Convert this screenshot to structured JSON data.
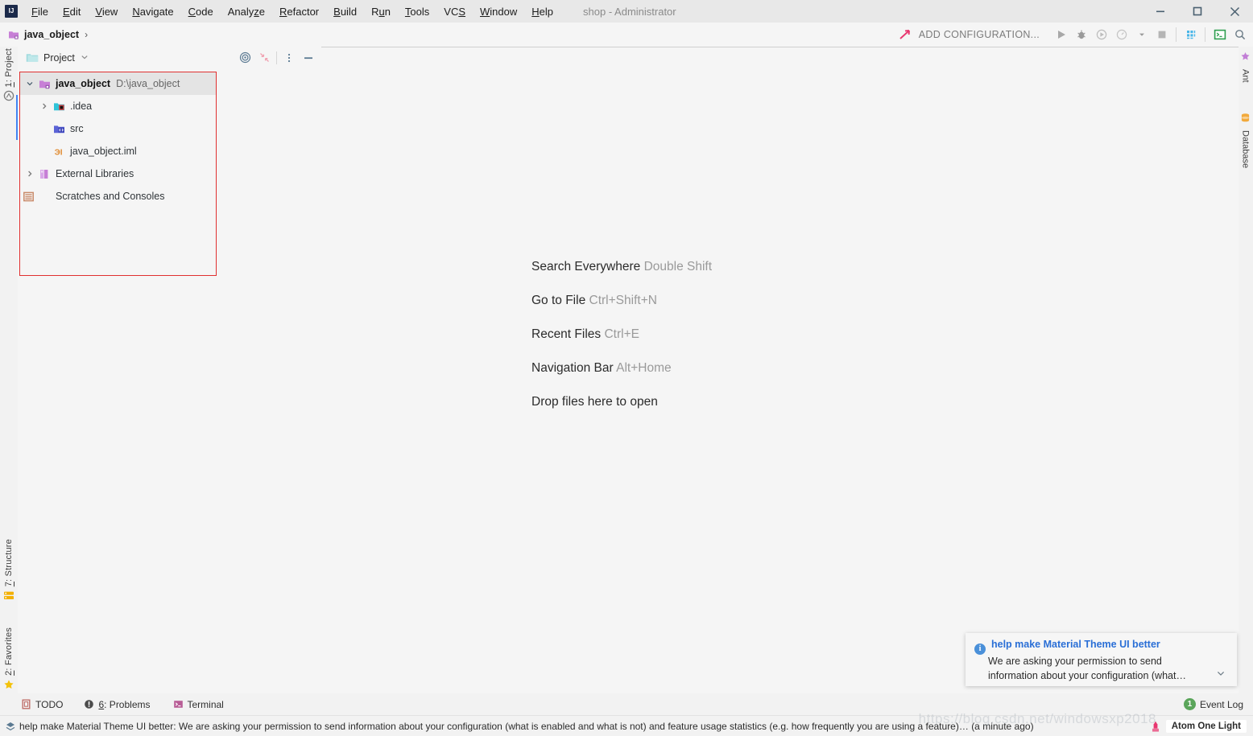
{
  "window": {
    "app_icon": "IJ",
    "title": "shop - Administrator",
    "controls": {
      "minimize": "minimize-icon",
      "maximize": "maximize-icon",
      "close": "close-icon"
    }
  },
  "menubar": {
    "items": [
      {
        "label": "File",
        "mnemonic": "F"
      },
      {
        "label": "Edit",
        "mnemonic": "E"
      },
      {
        "label": "View",
        "mnemonic": "V"
      },
      {
        "label": "Navigate",
        "mnemonic": "N"
      },
      {
        "label": "Code",
        "mnemonic": "C"
      },
      {
        "label": "Analyze",
        "mnemonic": "z"
      },
      {
        "label": "Refactor",
        "mnemonic": "R"
      },
      {
        "label": "Build",
        "mnemonic": "B"
      },
      {
        "label": "Run",
        "mnemonic": "u"
      },
      {
        "label": "Tools",
        "mnemonic": "T"
      },
      {
        "label": "VCS",
        "mnemonic": "S"
      },
      {
        "label": "Window",
        "mnemonic": "W"
      },
      {
        "label": "Help",
        "mnemonic": "H"
      }
    ]
  },
  "navbar": {
    "breadcrumb": {
      "label": "java_object",
      "separator": "›",
      "icon": "module-folder-icon"
    },
    "run_config": "ADD CONFIGURATION...",
    "buttons": [
      {
        "name": "run-button",
        "icon": "play-icon"
      },
      {
        "name": "debug-button",
        "icon": "bug-icon"
      },
      {
        "name": "run-with-coverage-button",
        "icon": "coverage-icon"
      },
      {
        "name": "profiler-button",
        "icon": "profiler-icon"
      },
      {
        "name": "profiler-dropdown",
        "icon": "chevron-down-icon"
      },
      {
        "name": "stop-button",
        "icon": "stop-square-icon"
      },
      {
        "name": "app-grid-button",
        "icon": "grid-icon"
      },
      {
        "name": "terminal-button",
        "icon": "terminal-icon"
      },
      {
        "name": "search-button",
        "icon": "search-icon"
      }
    ]
  },
  "left_strip": {
    "tabs": [
      {
        "label": "1: Project",
        "mnemonic": "1",
        "icon": "project-icon",
        "active": true
      },
      {
        "label": "7: Structure",
        "mnemonic": "7",
        "icon": "structure-icon",
        "active": false
      },
      {
        "label": "2: Favorites",
        "mnemonic": "2",
        "icon": "star-icon",
        "active": false
      }
    ],
    "bottom_icon": "layers-icon"
  },
  "right_strip": {
    "tabs": [
      {
        "label": "Ant",
        "icon": "ant-icon"
      },
      {
        "label": "Database",
        "icon": "database-icon"
      }
    ]
  },
  "project_panel": {
    "title": "Project",
    "title_chevron": "chevron-down-icon",
    "actions": [
      {
        "name": "select-opened-file-button",
        "icon": "target-icon"
      },
      {
        "name": "collapse-all-button",
        "icon": "collapse-all-icon"
      },
      {
        "name": "options-button",
        "icon": "vertical-dots-icon"
      },
      {
        "name": "hide-button",
        "icon": "minus-icon"
      }
    ],
    "tree": [
      {
        "label": "java_object",
        "path": "D:\\java_object",
        "icon": "module-folder-icon",
        "arrow": "expanded",
        "indent": 0,
        "selected": true,
        "bold": true
      },
      {
        "label": ".idea",
        "path": "",
        "icon": "idea-folder-icon",
        "arrow": "collapsed",
        "indent": 1,
        "selected": false,
        "bold": false
      },
      {
        "label": "src",
        "path": "",
        "icon": "source-folder-icon",
        "arrow": "none",
        "indent": 1,
        "selected": false,
        "bold": false
      },
      {
        "label": "java_object.iml",
        "path": "",
        "icon": "iml-file-icon",
        "arrow": "none",
        "indent": 1,
        "selected": false,
        "bold": false
      },
      {
        "label": "External Libraries",
        "path": "",
        "icon": "libraries-icon",
        "arrow": "collapsed",
        "indent": 0,
        "selected": false,
        "bold": false
      },
      {
        "label": "Scratches and Consoles",
        "path": "",
        "icon": "scratches-icon",
        "arrow": "none",
        "indent": 0,
        "selected": false,
        "bold": false
      }
    ]
  },
  "editor": {
    "hints": [
      {
        "action": "Search Everywhere",
        "shortcut": "Double Shift"
      },
      {
        "action": "Go to File",
        "shortcut": "Ctrl+Shift+N"
      },
      {
        "action": "Recent Files",
        "shortcut": "Ctrl+E"
      },
      {
        "action": "Navigation Bar",
        "shortcut": "Alt+Home"
      },
      {
        "action": "Drop files here to open",
        "shortcut": ""
      }
    ]
  },
  "notification": {
    "icon": "info-icon",
    "title": "help make Material Theme UI better",
    "body": "We are asking your permission to send information about your configuration (what…",
    "expand_icon": "chevron-down-icon"
  },
  "bottom_bar": {
    "buttons": [
      {
        "label": "TODO",
        "mnemonic": "",
        "icon": "todo-icon"
      },
      {
        "label": "6: Problems",
        "mnemonic": "6",
        "icon": "problems-icon"
      },
      {
        "label": "Terminal",
        "mnemonic": "",
        "icon": "terminal-icon"
      }
    ],
    "event_log": {
      "label": "Event Log",
      "count": "1"
    }
  },
  "status_bar": {
    "icon": "material-diamond-icon",
    "message": "help make Material Theme UI better: We are asking your permission to send information about your configuration (what is enabled and what is not) and feature usage statistics (e.g. how frequently you are using a feature)… (a minute ago)",
    "theme": {
      "label": "Atom One Light",
      "icon": "theme-icon"
    }
  },
  "watermark": "https://blog.csdn.net/windowsxp2018",
  "colors": {
    "accent_blue": "#4285f4",
    "link_blue": "#2a6fd6",
    "selection_gray": "#e4e4e4",
    "highlight_red": "#e03030",
    "editor_bg": "#f5f5f5",
    "chrome_bg": "#f2f2f2",
    "titlebar_bg": "#e8e8e8",
    "folder_purple": "#c77fd6",
    "badge_green": "#5aa55a",
    "theme_pink": "#e8366f"
  }
}
